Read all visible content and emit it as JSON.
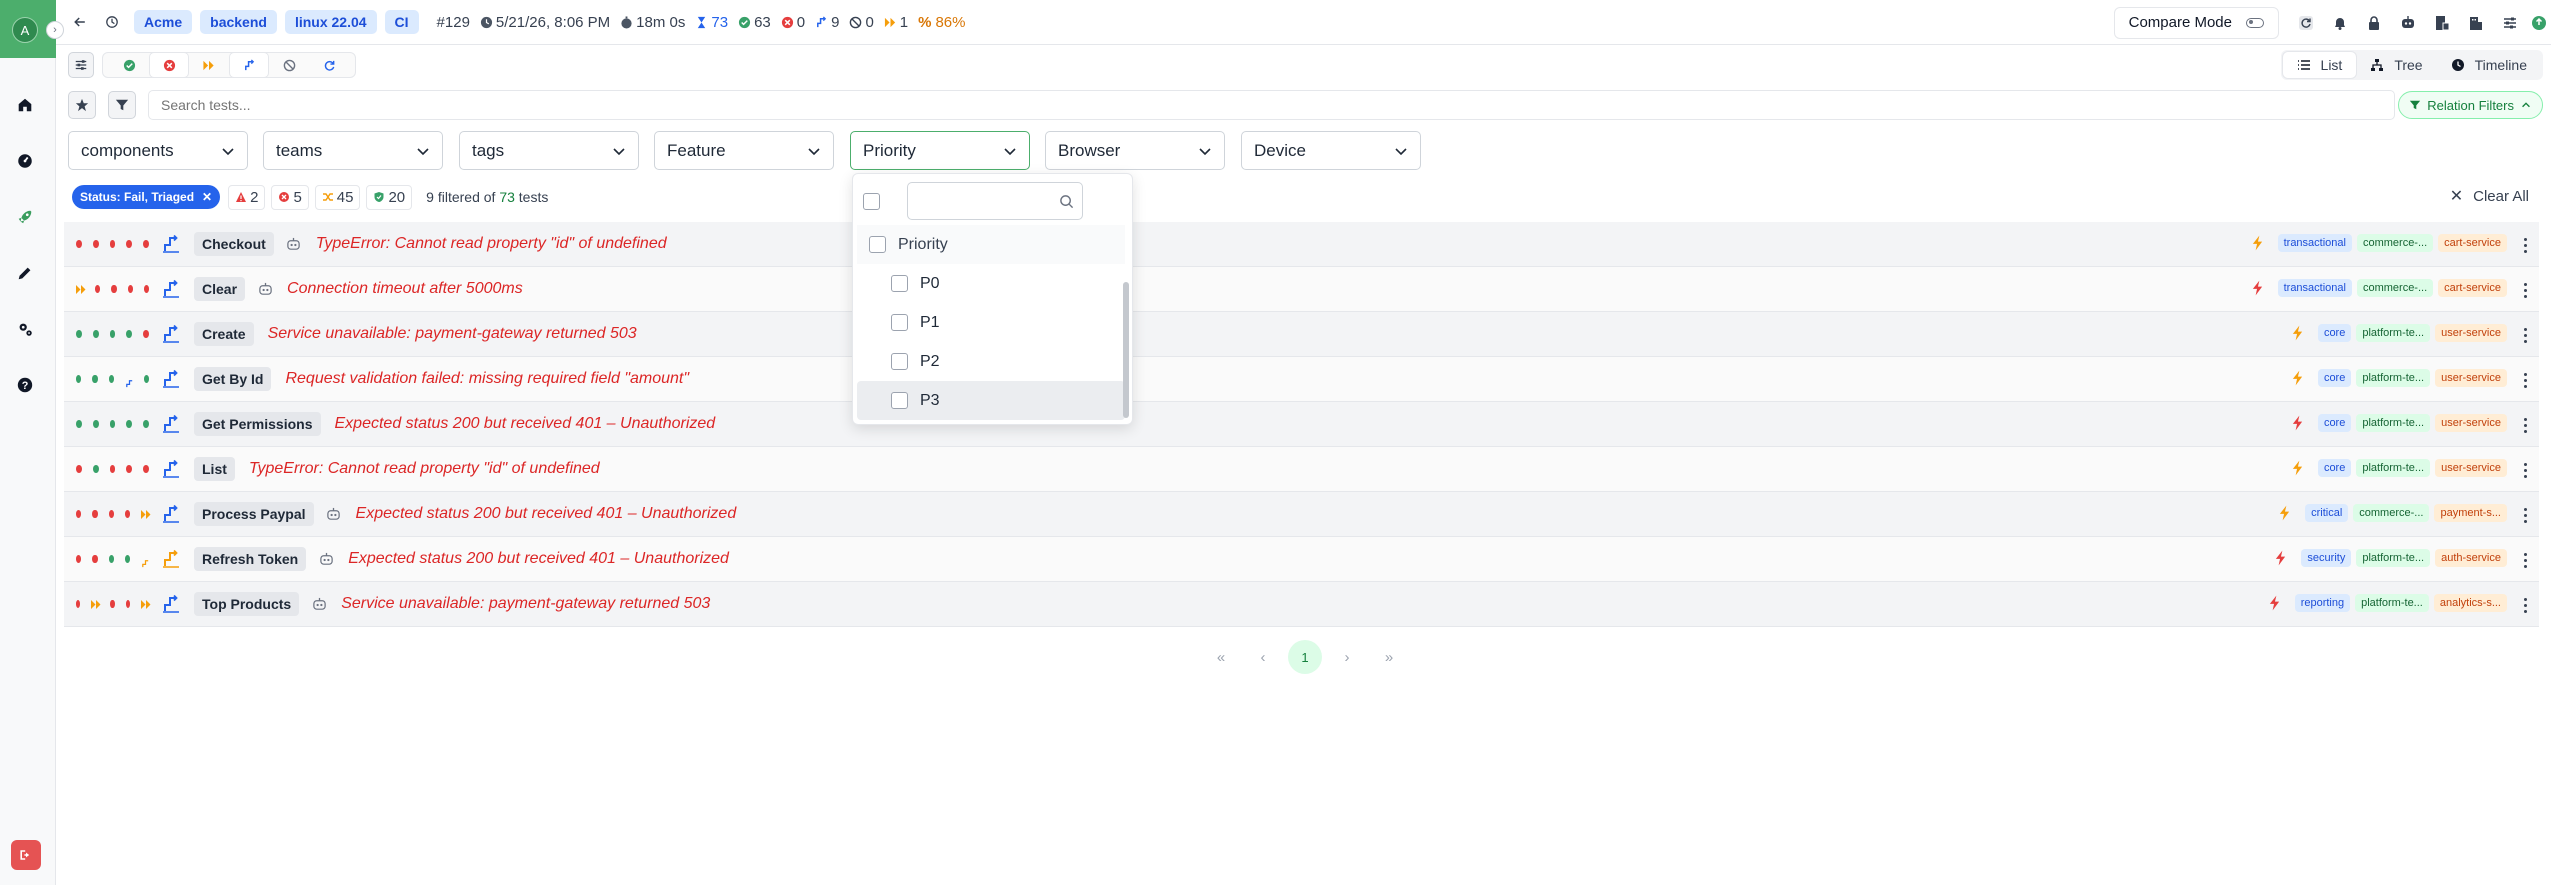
{
  "sidebar": {
    "avatar": "A"
  },
  "header": {
    "crumbs": [
      "Acme",
      "backend",
      "linux 22.04",
      "CI"
    ],
    "run_number": "#129",
    "timestamp": "5/21/26, 8:06 PM",
    "duration": "18m 0s",
    "total": "73",
    "passed": "63",
    "failed": "0",
    "flaky": "9",
    "skipped": "0",
    "retried": "1",
    "pass_rate": "86%",
    "compare_mode": "Compare Mode"
  },
  "views": {
    "list": "List",
    "tree": "Tree",
    "timeline": "Timeline"
  },
  "search": {
    "placeholder": "Search tests..."
  },
  "relation_filters": "Relation Filters",
  "dropdowns": [
    "components",
    "teams",
    "tags",
    "Feature",
    "Priority",
    "Browser",
    "Device"
  ],
  "status_chip": "Status: Fail, Triaged",
  "counts": {
    "warnings": "2",
    "failed": "5",
    "flaky": "45",
    "passed": "20"
  },
  "filter_summary": {
    "prefix": "9 filtered of ",
    "total": "73",
    "suffix": " tests"
  },
  "clear_all": "Clear All",
  "priority_popup": {
    "header": "Priority",
    "options": [
      "P0",
      "P1",
      "P2",
      "P3"
    ]
  },
  "tests": [
    {
      "name": "Checkout",
      "error": "TypeError: Cannot read property \"id\" of undefined",
      "tags": [
        "transactional",
        "commerce-...",
        "cart-service"
      ],
      "dots": [
        "red",
        "red",
        "red",
        "red",
        "red"
      ],
      "bot": true,
      "bolt": "orange"
    },
    {
      "name": "Clear",
      "error": "Connection timeout after 5000ms",
      "tags": [
        "transactional",
        "commerce-...",
        "cart-service"
      ],
      "dots": [
        "flk",
        "red",
        "red",
        "red",
        "red"
      ],
      "bot": true,
      "bolt": "red"
    },
    {
      "name": "Create",
      "error": "Service unavailable: payment-gateway returned 503",
      "tags": [
        "core",
        "platform-te...",
        "user-service"
      ],
      "dots": [
        "grn",
        "grn",
        "grn",
        "grn",
        "red"
      ],
      "bot": false,
      "bolt": "orange"
    },
    {
      "name": "Get By Id",
      "error": "Request validation failed: missing required field \"amount\"",
      "tags": [
        "core",
        "platform-te...",
        "user-service"
      ],
      "dots": [
        "grn",
        "grn",
        "grn",
        "ret",
        "grn"
      ],
      "bot": false,
      "bolt": "orange"
    },
    {
      "name": "Get Permissions",
      "error": "Expected status 200 but received 401 – Unauthorized",
      "tags": [
        "core",
        "platform-te...",
        "user-service"
      ],
      "dots": [
        "grn",
        "grn",
        "grn",
        "grn",
        "grn"
      ],
      "bot": false,
      "bolt": "red"
    },
    {
      "name": "List",
      "error": "TypeError: Cannot read property \"id\" of undefined",
      "tags": [
        "core",
        "platform-te...",
        "user-service"
      ],
      "dots": [
        "red",
        "grn",
        "red",
        "red",
        "red"
      ],
      "bot": false,
      "bolt": "orange"
    },
    {
      "name": "Process Paypal",
      "error": "Expected status 200 but received 401 – Unauthorized",
      "tags": [
        "critical",
        "commerce-...",
        "payment-s..."
      ],
      "dots": [
        "red",
        "red",
        "red",
        "red",
        "flk"
      ],
      "bot": true,
      "bolt": "orange"
    },
    {
      "name": "Refresh Token",
      "error": "Expected status 200 but received 401 – Unauthorized",
      "tags": [
        "security",
        "platform-te...",
        "auth-service"
      ],
      "dots": [
        "red",
        "red",
        "grn",
        "grn",
        "ret"
      ],
      "bot": true,
      "bolt": "red"
    },
    {
      "name": "Top Products",
      "error": "Service unavailable: payment-gateway returned 503",
      "tags": [
        "reporting",
        "platform-te...",
        "analytics-s..."
      ],
      "dots": [
        "red",
        "flk",
        "red",
        "red",
        "flk"
      ],
      "bot": true,
      "bolt": "red"
    }
  ],
  "pagination": {
    "current": "1"
  },
  "colors": {
    "brand": "#4cae6c",
    "fail": "#dc2626",
    "pass": "#38a169",
    "accent": "#2563eb"
  }
}
